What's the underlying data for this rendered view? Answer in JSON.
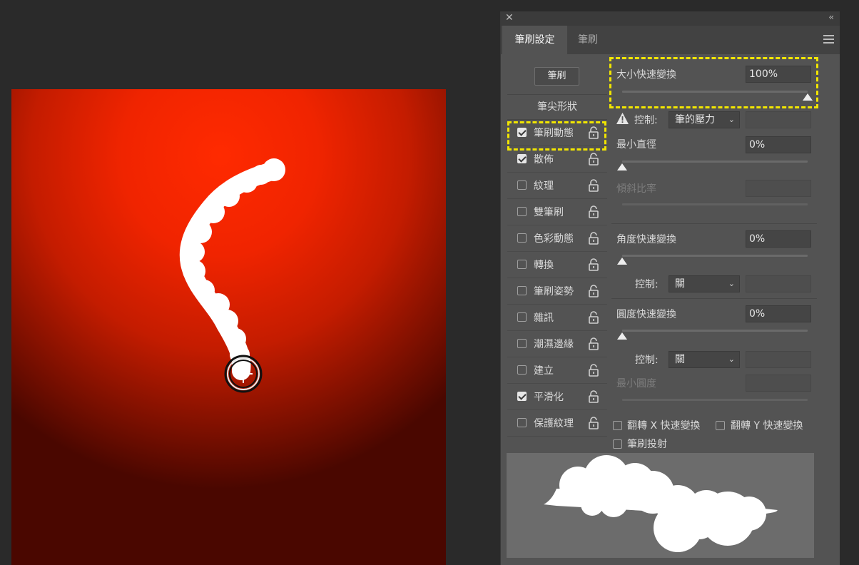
{
  "panel": {
    "tabs": [
      {
        "label": "筆刷設定",
        "active": true
      },
      {
        "label": "筆刷",
        "active": false
      }
    ],
    "brush_button": "筆刷",
    "tip_shape": "筆尖形狀",
    "options": [
      {
        "label": "筆刷動態",
        "checked": true
      },
      {
        "label": "散佈",
        "checked": true
      },
      {
        "label": "紋理",
        "checked": false
      },
      {
        "label": "雙筆刷",
        "checked": false
      },
      {
        "label": "色彩動態",
        "checked": false
      },
      {
        "label": "轉換",
        "checked": false
      },
      {
        "label": "筆刷姿勢",
        "checked": false
      },
      {
        "label": "雜訊",
        "checked": false
      },
      {
        "label": "潮濕邊緣",
        "checked": false
      },
      {
        "label": "建立",
        "checked": false
      },
      {
        "label": "平滑化",
        "checked": true
      },
      {
        "label": "保護紋理",
        "checked": false
      }
    ],
    "size_jitter": {
      "label": "大小快速變換",
      "value": "100%",
      "level": 1.0
    },
    "control_1": {
      "label": "控制:",
      "value": "筆的壓力"
    },
    "min_diameter": {
      "label": "最小直徑",
      "value": "0%",
      "level": 0.0
    },
    "tilt_scale": {
      "label": "傾斜比率"
    },
    "angle_jitter": {
      "label": "角度快速變換",
      "value": "0%",
      "level": 0.0
    },
    "control_2": {
      "label": "控制:",
      "value": "關"
    },
    "roundness_jitter": {
      "label": "圓度快速變換",
      "value": "0%",
      "level": 0.0
    },
    "control_3": {
      "label": "控制:",
      "value": "關"
    },
    "min_roundness": {
      "label": "最小圓度"
    },
    "flip_x": "翻轉 X 快速變換",
    "flip_y": "翻轉 Y 快速變換",
    "projection": "筆刷投射"
  },
  "colors": {
    "highlight": "#f2e600",
    "canvas_center": "#ff2a00",
    "panel_bg": "#535353"
  }
}
